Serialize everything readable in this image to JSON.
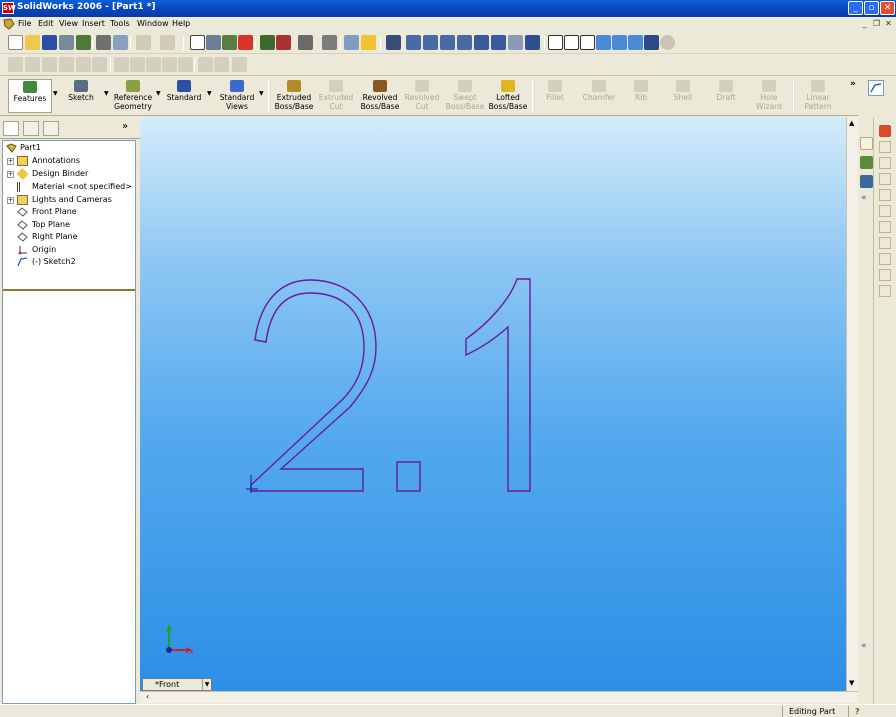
{
  "window": {
    "title": "SolidWorks 2006 - [Part1 *]",
    "app_icon_text": "SW"
  },
  "menu": {
    "items": [
      "File",
      "Edit",
      "View",
      "Insert",
      "Tools",
      "Window",
      "Help"
    ]
  },
  "command_manager": {
    "items": [
      {
        "label": "Features",
        "enabled": true,
        "active": true
      },
      {
        "label": "Sketch",
        "enabled": true
      },
      {
        "label": "Reference Geometry",
        "enabled": true
      },
      {
        "label": "Standard",
        "enabled": true
      },
      {
        "label": "Standard Views",
        "enabled": true
      },
      {
        "label": "Extruded Boss/Base",
        "enabled": true
      },
      {
        "label": "Extruded Cut",
        "enabled": false
      },
      {
        "label": "Revolved Boss/Base",
        "enabled": true
      },
      {
        "label": "Revolved Cut",
        "enabled": false
      },
      {
        "label": "Swept Boss/Base",
        "enabled": false
      },
      {
        "label": "Lofted Boss/Base",
        "enabled": true
      },
      {
        "label": "Fillet",
        "enabled": false
      },
      {
        "label": "Chamfer",
        "enabled": false
      },
      {
        "label": "Rib",
        "enabled": false
      },
      {
        "label": "Shell",
        "enabled": false
      },
      {
        "label": "Draft",
        "enabled": false
      },
      {
        "label": "Hole Wizard",
        "enabled": false
      },
      {
        "label": "Linear Pattern",
        "enabled": false
      }
    ]
  },
  "feature_tree": {
    "root": "Part1",
    "nodes": [
      {
        "label": "Annotations",
        "expandable": true,
        "icon": "annotations-icon"
      },
      {
        "label": "Design Binder",
        "expandable": true,
        "icon": "design-binder-icon"
      },
      {
        "label": "Material <not specified>",
        "expandable": false,
        "icon": "material-icon"
      },
      {
        "label": "Lights and Cameras",
        "expandable": true,
        "icon": "lights-cameras-icon"
      },
      {
        "label": "Front Plane",
        "expandable": false,
        "icon": "plane-icon"
      },
      {
        "label": "Top Plane",
        "expandable": false,
        "icon": "plane-icon"
      },
      {
        "label": "Right Plane",
        "expandable": false,
        "icon": "plane-icon"
      },
      {
        "label": "Origin",
        "expandable": false,
        "icon": "origin-icon"
      },
      {
        "label": "(-) Sketch2",
        "expandable": false,
        "icon": "sketch-icon"
      }
    ]
  },
  "viewport": {
    "view_name": "*Front",
    "sketch_text": "2.1",
    "triad_x": "X",
    "sketch_color": "#6a1a9a"
  },
  "status": {
    "mode": "Editing Part",
    "help": "?"
  },
  "colors": {
    "titlebar": "#0a4cc8",
    "viewport_top": "#d3ecfb",
    "viewport_bottom": "#2c8fe6",
    "sketch": "#6a1a9a"
  }
}
